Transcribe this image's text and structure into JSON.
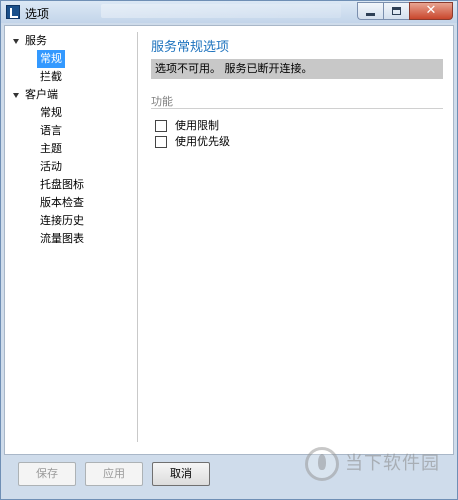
{
  "window": {
    "title": "选项",
    "controls": {
      "minimize_icon": "minimize-icon",
      "maximize_icon": "maximize-icon",
      "close_icon": "close-icon",
      "close_glyph": "✕"
    }
  },
  "tree": {
    "categories": [
      {
        "label": "服务",
        "children": [
          {
            "label": "常规",
            "selected": true
          },
          {
            "label": "拦截",
            "selected": false
          }
        ]
      },
      {
        "label": "客户端",
        "children": [
          {
            "label": "常规"
          },
          {
            "label": "语言"
          },
          {
            "label": "主题"
          },
          {
            "label": "活动"
          },
          {
            "label": "托盘图标"
          },
          {
            "label": "版本检查"
          },
          {
            "label": "连接历史"
          },
          {
            "label": "流量图表"
          }
        ]
      }
    ]
  },
  "panel": {
    "title": "服务常规选项",
    "info": "选项不可用。 服务已断开连接。",
    "section_label": "功能",
    "checkboxes": [
      {
        "label": "使用限制",
        "checked": false
      },
      {
        "label": "使用优先级",
        "checked": false
      }
    ]
  },
  "footer": {
    "save_label": "保存",
    "apply_label": "应用",
    "cancel_label": "取消"
  },
  "watermark": {
    "text": "当下软件园"
  },
  "colors": {
    "selection": "#3399ff",
    "panel_title": "#1e73be",
    "info_bar": "#c8c8c8"
  }
}
